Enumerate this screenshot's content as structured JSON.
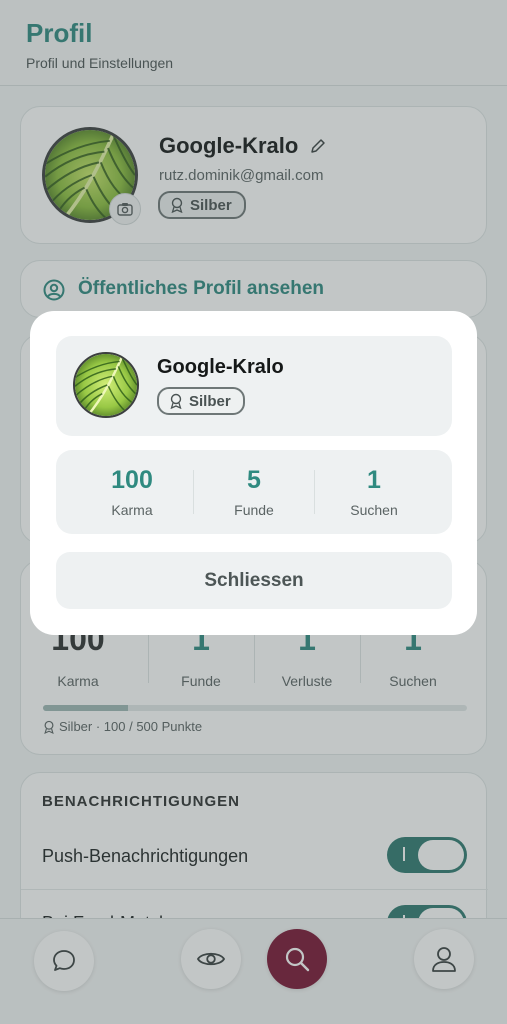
{
  "header": {
    "title": "Profil",
    "subtitle": "Profil und Einstellungen"
  },
  "profile": {
    "username": "Google-Kralo",
    "email": "rutz.dominik@gmail.com",
    "badge": "Silber",
    "avatar_icon": "leaf-photo",
    "camera_icon": "camera-icon",
    "edit_icon": "pencil-icon"
  },
  "public_profile": {
    "label": "Öffentliches Profil ansehen",
    "icon": "user-circle-icon"
  },
  "stats": {
    "items": [
      {
        "value": "100",
        "label": "Karma"
      },
      {
        "value": "1",
        "label": "Funde"
      },
      {
        "value": "1",
        "label": "Verluste"
      },
      {
        "value": "1",
        "label": "Suchen"
      }
    ],
    "progress": 0.2,
    "level_text": "Silber · 100 / 500 Punkte"
  },
  "notifications": {
    "title": "BENACHRICHTIGUNGEN",
    "items": [
      {
        "label": "Push-Benachrichtigungen",
        "enabled": true
      },
      {
        "label": "Bei Fund-Match",
        "enabled": true
      }
    ]
  },
  "bottom_nav": {
    "items": [
      {
        "icon": "chat-icon"
      },
      {
        "icon": "eye-icon"
      },
      {
        "icon": "search-icon",
        "active": true
      },
      {
        "icon": "user-icon"
      }
    ]
  },
  "modal": {
    "username": "Google-Kralo",
    "badge": "Silber",
    "stats": [
      {
        "value": "100",
        "label": "Karma"
      },
      {
        "value": "5",
        "label": "Funde"
      },
      {
        "value": "1",
        "label": "Suchen"
      }
    ],
    "close_label": "Schliessen"
  },
  "colors": {
    "accent": "#2f8a80",
    "toggle_on": "#2f7a70",
    "search_active": "#7a1433",
    "surface": "#eef1f2"
  }
}
